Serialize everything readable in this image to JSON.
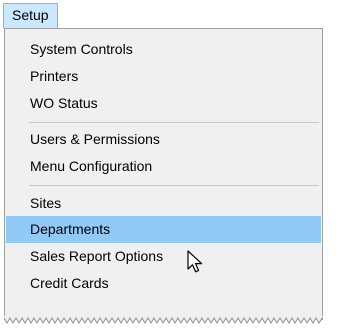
{
  "menubar": {
    "setup_label": "Setup"
  },
  "menu": {
    "items": [
      {
        "label": "System Controls"
      },
      {
        "label": "Printers"
      },
      {
        "label": "WO Status"
      },
      {
        "label": "Users & Permissions"
      },
      {
        "label": "Menu Configuration"
      },
      {
        "label": "Sites"
      },
      {
        "label": "Departments"
      },
      {
        "label": "Sales Report Options"
      },
      {
        "label": "Credit Cards"
      }
    ],
    "selected_item": "Departments"
  },
  "cursor": {
    "icon": "mouse-pointer-icon"
  },
  "colors": {
    "menu_background": "#f0f0f0",
    "highlight": "#91c9f7",
    "menubar_active": "#cce8ff",
    "border": "#a0a0a0"
  }
}
